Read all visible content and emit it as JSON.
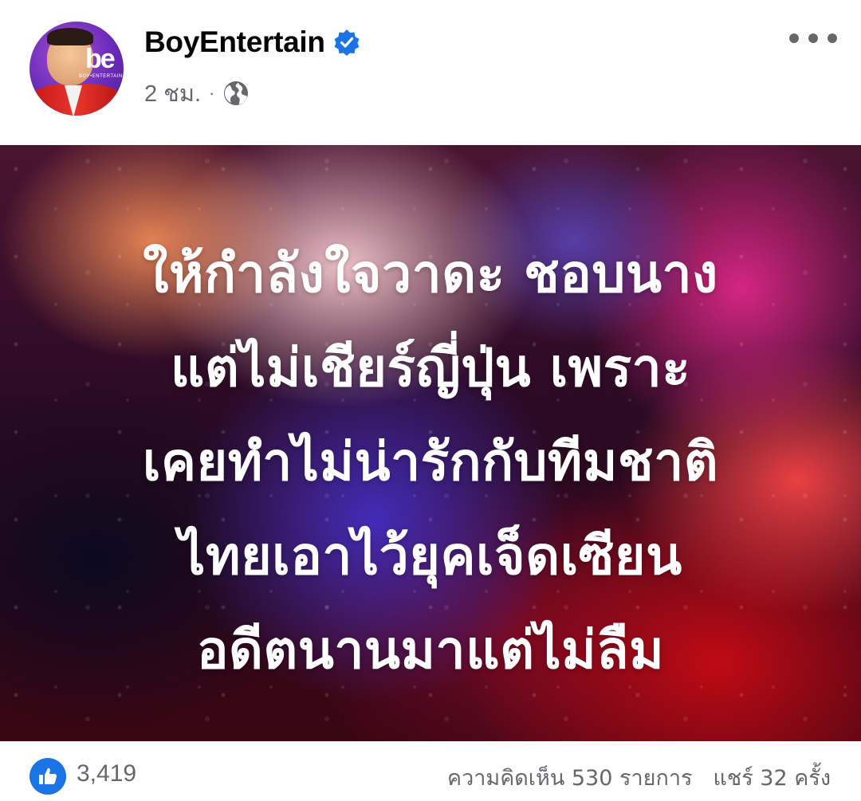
{
  "post": {
    "page_name": "BoyEntertain",
    "avatar_logo": "be",
    "avatar_logo_sub": "BOY•ENTERTAIN",
    "timestamp": "2 ชม.",
    "separator": "·",
    "verified_icon": "verified-badge-icon",
    "privacy_icon": "globe-icon",
    "more_icon": "more-horizontal-icon"
  },
  "image": {
    "lines": [
      "ให้กำลังใจวาดะ ชอบนาง",
      "แต่ไม่เชียร์ญี่ปุ่น เพราะ",
      "เคยทำไม่น่ารักกับทีมชาติ",
      "ไทยเอาไว้ยุคเจ็ดเซียน",
      "อดีตนานมาแต่ไม่ลืม"
    ]
  },
  "stats": {
    "likes": "3,419",
    "comments": "ความคิดเห็น 530 รายการ",
    "shares": "แชร์ 32 ครั้ง",
    "like_icon": "thumbs-up-icon"
  },
  "colors": {
    "accent": "#1b74e4",
    "text_primary": "#050505",
    "text_secondary": "#65676b"
  }
}
